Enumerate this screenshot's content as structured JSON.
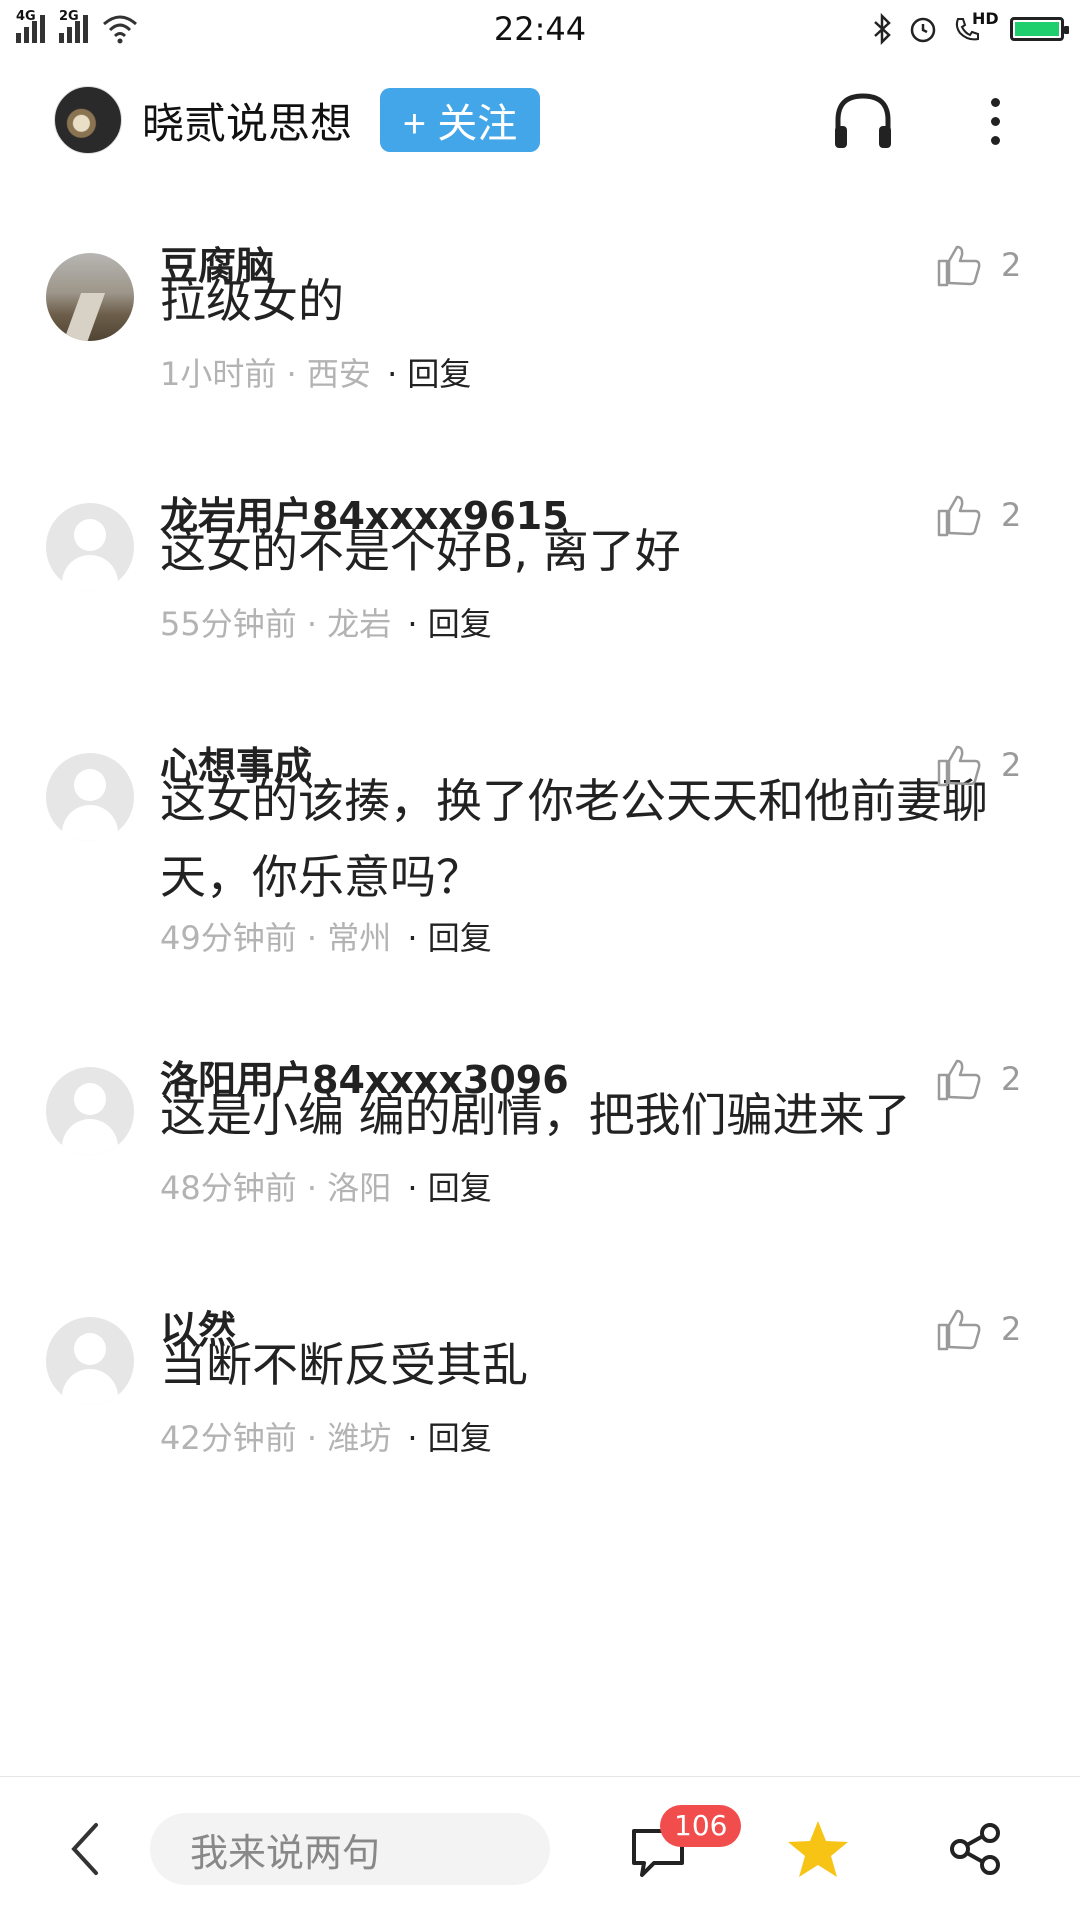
{
  "status_bar": {
    "time": "22:44",
    "network_1": "4G",
    "network_2": "2G",
    "hd_label": "HD"
  },
  "header": {
    "author_name": "晓贰说思想",
    "follow_label": "+ 关注"
  },
  "comments": [
    {
      "name": "豆腐脑",
      "text": "拉级女的",
      "time_location": "1小时前 · 西安",
      "reply": "· 回复",
      "likes": "2",
      "avatar": "photo"
    },
    {
      "name": "龙岩用户84xxxx9615",
      "text": "这女的不是个好B, 离了好",
      "time_location": "55分钟前 · 龙岩",
      "reply": "· 回复",
      "likes": "2",
      "avatar": "default"
    },
    {
      "name": "心想事成",
      "text": "这女的该揍，换了你老公天天和他前妻聊天，你乐意吗？",
      "time_location": "49分钟前 · 常州",
      "reply": "· 回复",
      "likes": "2",
      "avatar": "default"
    },
    {
      "name": "洛阳用户84xxxx3096",
      "text": "这是小编 编的剧情，把我们骗进来了",
      "time_location": "48分钟前 · 洛阳",
      "reply": "· 回复",
      "likes": "2",
      "avatar": "default"
    },
    {
      "name": "以然",
      "text": "当断不断反受其乱",
      "time_location": "42分钟前 · 潍坊",
      "reply": "· 回复",
      "likes": "2",
      "avatar": "default"
    }
  ],
  "bottom_bar": {
    "input_placeholder": "我来说两句",
    "comment_count": "106"
  },
  "colors": {
    "accent_blue": "#42a6e8",
    "badge_red": "#f14d4d",
    "star_yellow": "#f7c416",
    "battery_green": "#1fcf6e"
  }
}
